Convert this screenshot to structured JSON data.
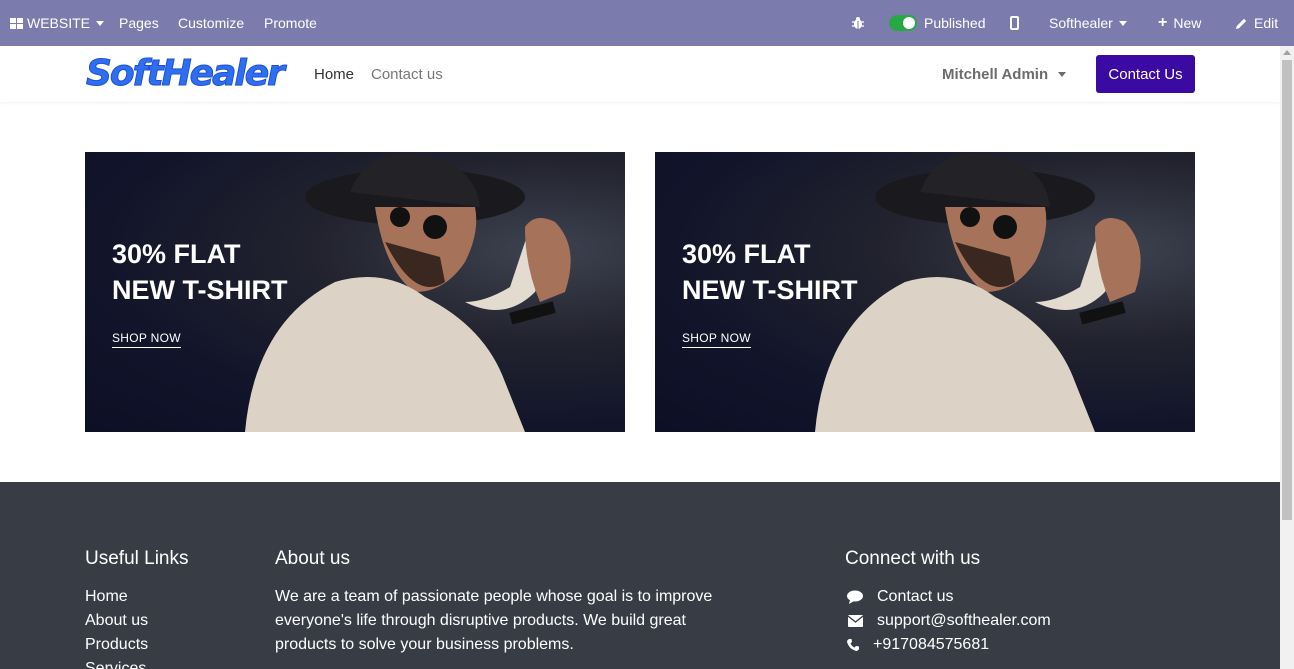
{
  "admin_bar": {
    "website_label": "WEBSITE",
    "pages_label": "Pages",
    "customize_label": "Customize",
    "promote_label": "Promote",
    "published_label": "Published",
    "company_label": "Softhealer",
    "new_label": "New",
    "edit_label": "Edit",
    "background": "#7c7bad",
    "toggle_color": "#28a745"
  },
  "header": {
    "logo_text": "SoftHealer",
    "nav": [
      {
        "label": "Home",
        "active": true
      },
      {
        "label": "Contact us",
        "active": false
      }
    ],
    "user_name": "Mitchell Admin",
    "contact_button": "Contact Us",
    "accent": "#3b0aa3"
  },
  "banners": [
    {
      "line1": "30% FLAT",
      "line2": "NEW T-SHIRT",
      "cta": "SHOP NOW"
    },
    {
      "line1": "30% FLAT",
      "line2": "NEW T-SHIRT",
      "cta": "SHOP NOW"
    }
  ],
  "footer": {
    "background": "#383c44",
    "useful_links": {
      "title": "Useful Links",
      "items": [
        "Home",
        "About us",
        "Products",
        "Services"
      ]
    },
    "about": {
      "title": "About us",
      "text": "We are a team of passionate people whose goal is to improve everyone's life through disruptive products. We build great products to solve your business problems."
    },
    "connect": {
      "title": "Connect with us",
      "items": [
        {
          "icon": "comment-icon",
          "text": "Contact us"
        },
        {
          "icon": "envelope-icon",
          "text": "support@softhealer.com"
        },
        {
          "icon": "phone-icon",
          "text": "+917084575681"
        }
      ]
    }
  }
}
